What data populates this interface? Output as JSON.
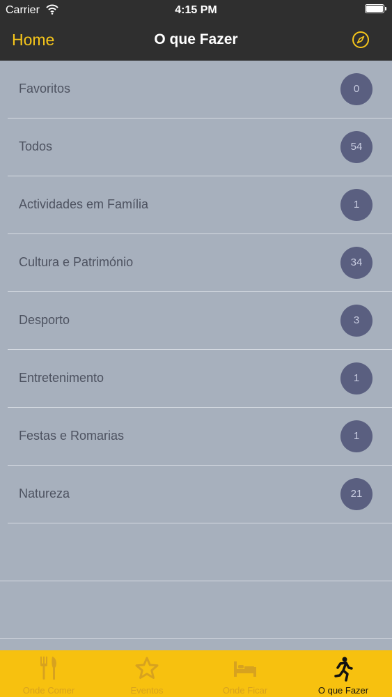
{
  "status_bar": {
    "carrier": "Carrier",
    "time": "4:15 PM"
  },
  "nav": {
    "back_label": "Home",
    "title": "O que Fazer",
    "accent_color": "#f6c61a"
  },
  "categories": [
    {
      "label": "Favoritos",
      "count": "0"
    },
    {
      "label": "Todos",
      "count": "54"
    },
    {
      "label": "Actividades em Família",
      "count": "1"
    },
    {
      "label": "Cultura e Património",
      "count": "34"
    },
    {
      "label": "Desporto",
      "count": "3"
    },
    {
      "label": "Entretenimento",
      "count": "1"
    },
    {
      "label": "Festas e Romarias",
      "count": "1"
    },
    {
      "label": "Natureza",
      "count": "21"
    }
  ],
  "tabbar": {
    "background": "#f7c10f",
    "tabs": [
      {
        "label": "Onde Comer",
        "icon": "fork-knife-icon",
        "active": false
      },
      {
        "label": "Eventos",
        "icon": "star-icon",
        "active": false
      },
      {
        "label": "Onde Ficar",
        "icon": "bed-icon",
        "active": false
      },
      {
        "label": "O que Fazer",
        "icon": "running-person-icon",
        "active": true
      }
    ]
  }
}
